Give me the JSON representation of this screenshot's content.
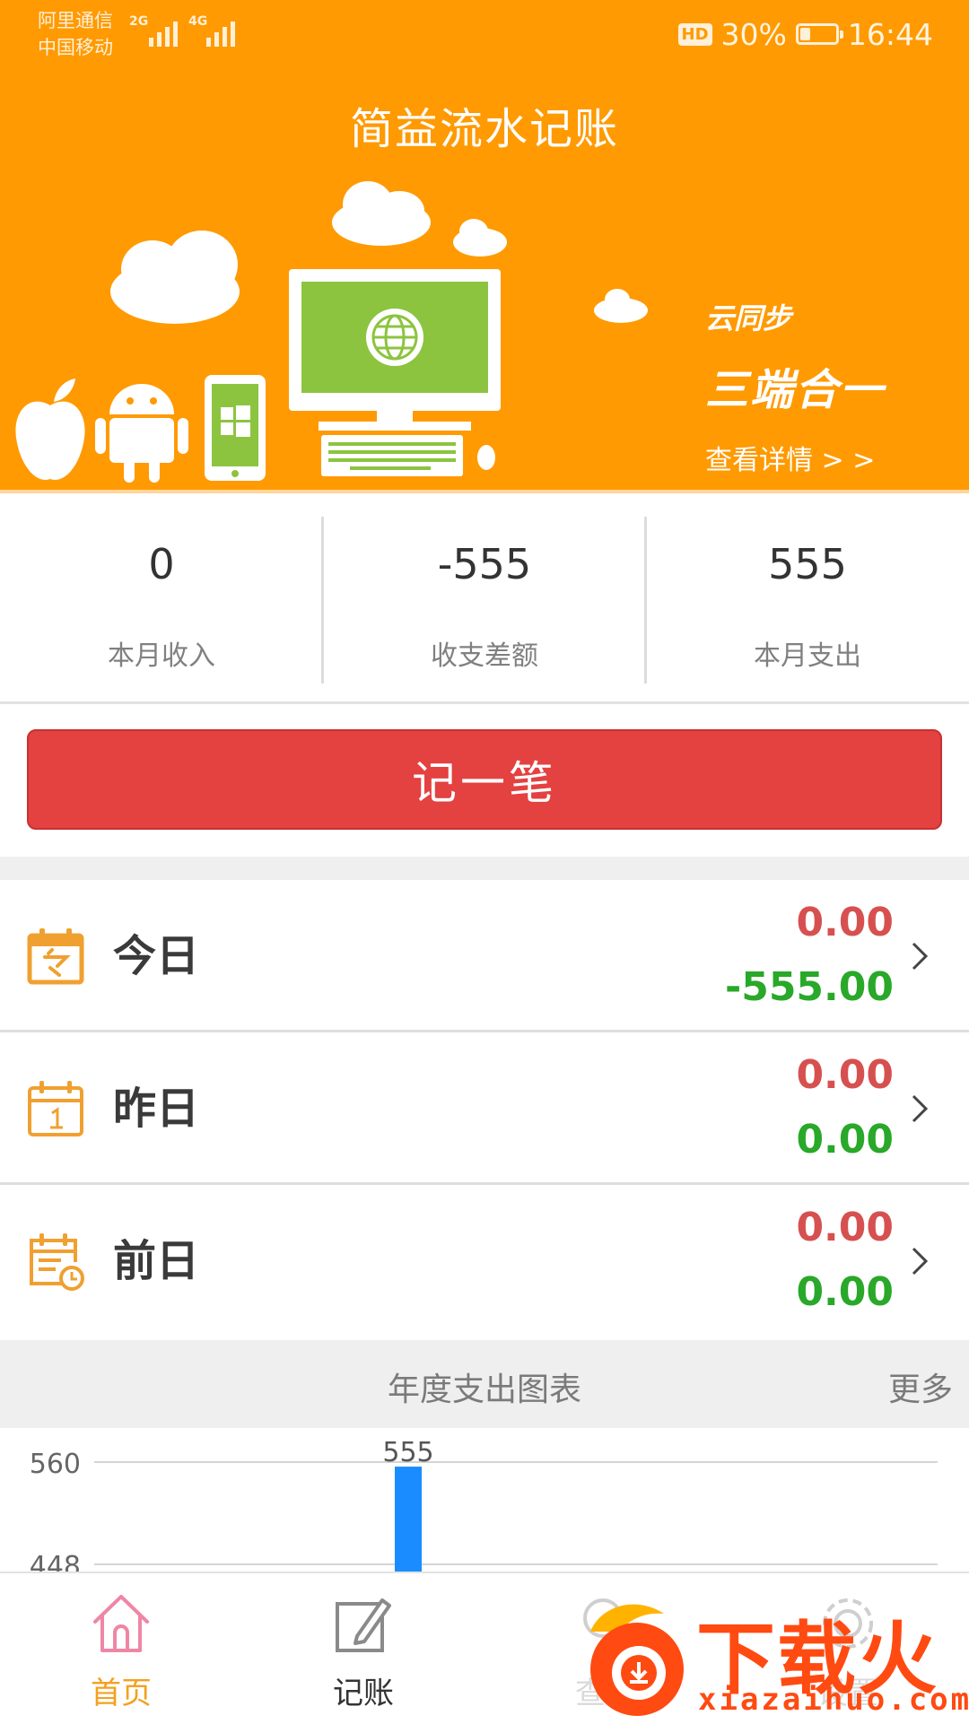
{
  "status_bar": {
    "carrier_1": "阿里通信",
    "carrier_2": "中国移动",
    "net_1": "2G",
    "net_2": "4G",
    "hd": "HD",
    "battery": "30%",
    "battery_level": 0.3,
    "time": "16:44"
  },
  "header": {
    "title": "简益流水记账",
    "promo_line1": "云同步",
    "promo_line2": "三端合一",
    "promo_link": "查看详情 > >"
  },
  "summary": {
    "income": {
      "value": "0",
      "label": "本月收入"
    },
    "balance": {
      "value": "-555",
      "label": "收支差额"
    },
    "expense": {
      "value": "555",
      "label": "本月支出"
    }
  },
  "record_button": "记一笔",
  "days": [
    {
      "name": "今日",
      "income": "0.00",
      "expense": "-555.00",
      "icon": "calendar-today-icon"
    },
    {
      "name": "昨日",
      "income": "0.00",
      "expense": "0.00",
      "icon": "calendar-yesterday-icon"
    },
    {
      "name": "前日",
      "income": "0.00",
      "expense": "0.00",
      "icon": "calendar-clock-icon"
    }
  ],
  "chart_section": {
    "title": "年度支出图表",
    "more": "更多"
  },
  "chart_data": {
    "type": "bar",
    "title": "年度支出图表",
    "y_ticks": [
      "560",
      "448"
    ],
    "values": [
      555
    ],
    "data_labels": [
      "555"
    ],
    "color": "#1a8cff"
  },
  "bottom_nav": [
    {
      "label": "首页",
      "icon": "home-icon",
      "active": true
    },
    {
      "label": "记账",
      "icon": "edit-icon",
      "active": false
    },
    {
      "label": "查询",
      "icon": "search-icon",
      "active": false
    },
    {
      "label": "设置",
      "icon": "settings-icon",
      "active": false
    }
  ],
  "watermark": {
    "text": "下载火",
    "url": "xiazaihuo.com"
  },
  "colors": {
    "header": "#ff9a02",
    "income": "#d75050",
    "expense": "#29a829",
    "button": "#e44141",
    "active_nav": "#f3a11f"
  }
}
